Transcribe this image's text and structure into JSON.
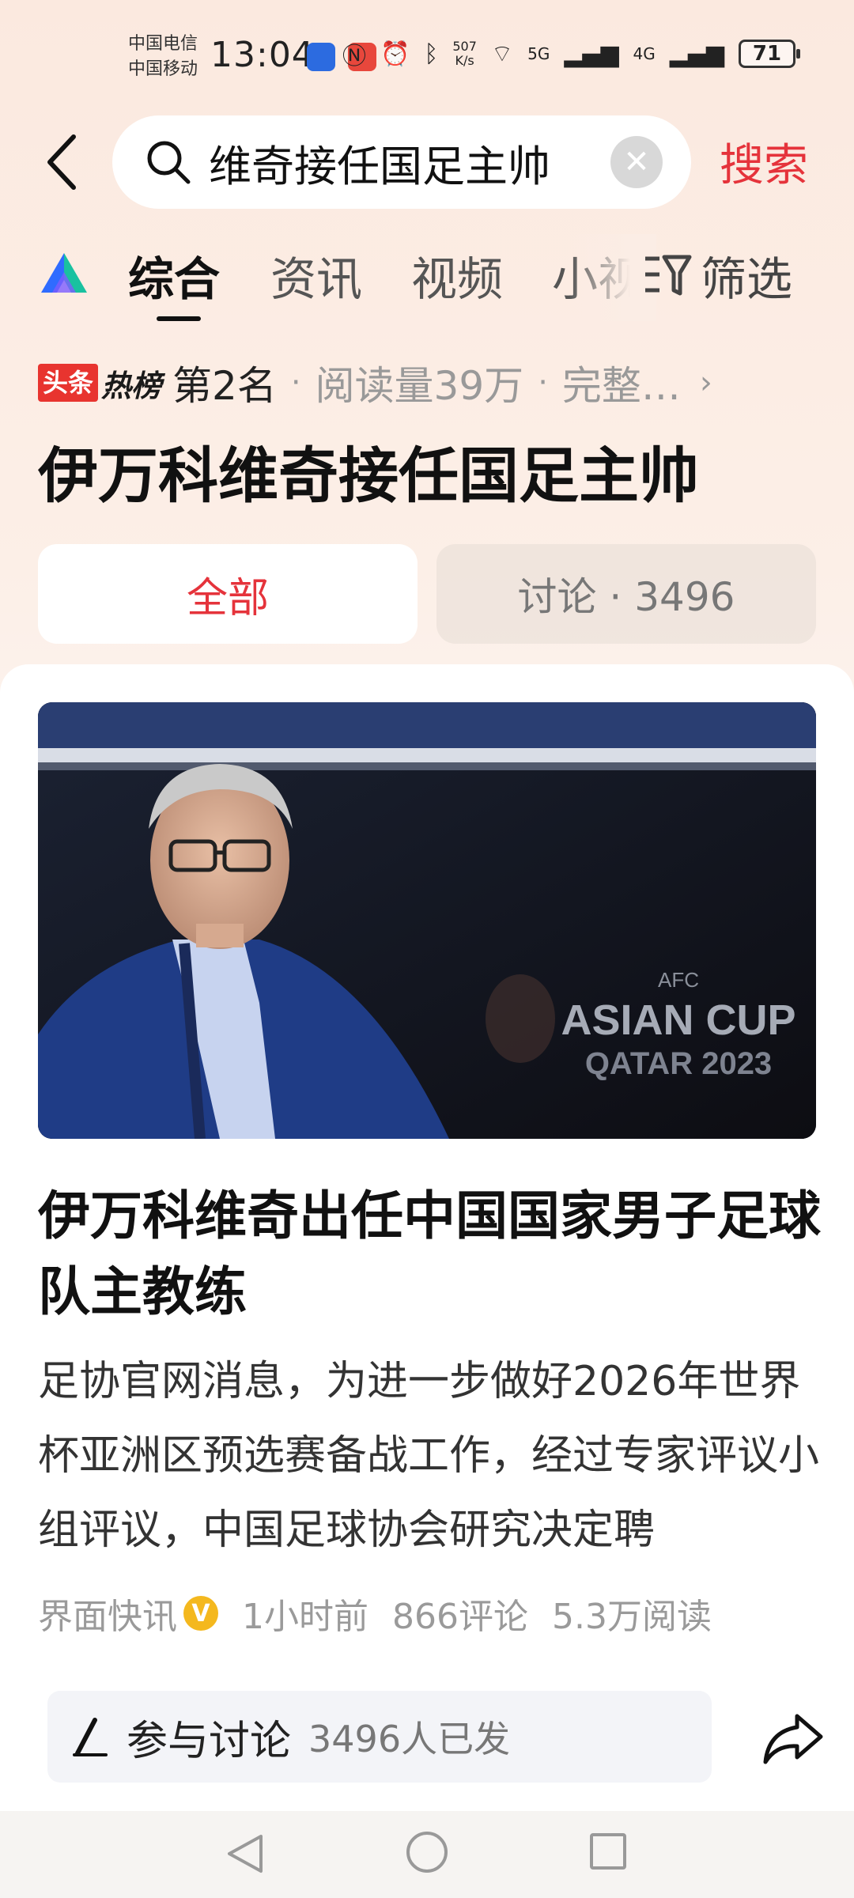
{
  "status_bar": {
    "carrier_1": "中国电信",
    "carrier_2": "中国移动",
    "time": "13:04",
    "net_speed_value": "507",
    "net_speed_unit": "K/s",
    "signal_1": "5G",
    "signal_2": "4G",
    "battery": "71",
    "icons": [
      "nfc-icon",
      "alarm-icon",
      "bluetooth-icon",
      "wifi-icon",
      "signal-icon",
      "battery-icon"
    ]
  },
  "search": {
    "query": "维奇接任国足主帅",
    "submit_label": "搜索"
  },
  "tabs": [
    {
      "label": "综合",
      "active": true
    },
    {
      "label": "资讯",
      "active": false
    },
    {
      "label": "视频",
      "active": false
    },
    {
      "label": "小视",
      "active": false
    }
  ],
  "filter_label": "筛选",
  "hot_list": {
    "badge_1": "头条",
    "badge_2": "热榜",
    "rank": "第2名",
    "reads": "阅读量39万",
    "more": "完整…"
  },
  "topic_title": "伊万科维奇接任国足主帅",
  "segments": {
    "all_label": "全部",
    "discussion_label": "讨论 · 3496"
  },
  "article": {
    "title": "伊万科维奇出任中国国家男子足球队主教练",
    "summary": "足协官网消息，为进一步做好2026年世界杯亚洲区预选赛备战工作，经过专家评议小组评议，中国足球协会研究决定聘",
    "source": "界面快讯",
    "verified_mark": "V",
    "time": "1小时前",
    "comments": "866评论",
    "reads": "5.3万阅读",
    "photo_text_1": "AFC",
    "photo_text_2": "ASIAN CUP",
    "photo_text_3": "QATAR 2023"
  },
  "discussion_bar": {
    "label": "参与讨论",
    "count": "3496人已发"
  },
  "colors": {
    "accent_red": "#e5333b",
    "verified_yellow": "#f4b81e"
  }
}
